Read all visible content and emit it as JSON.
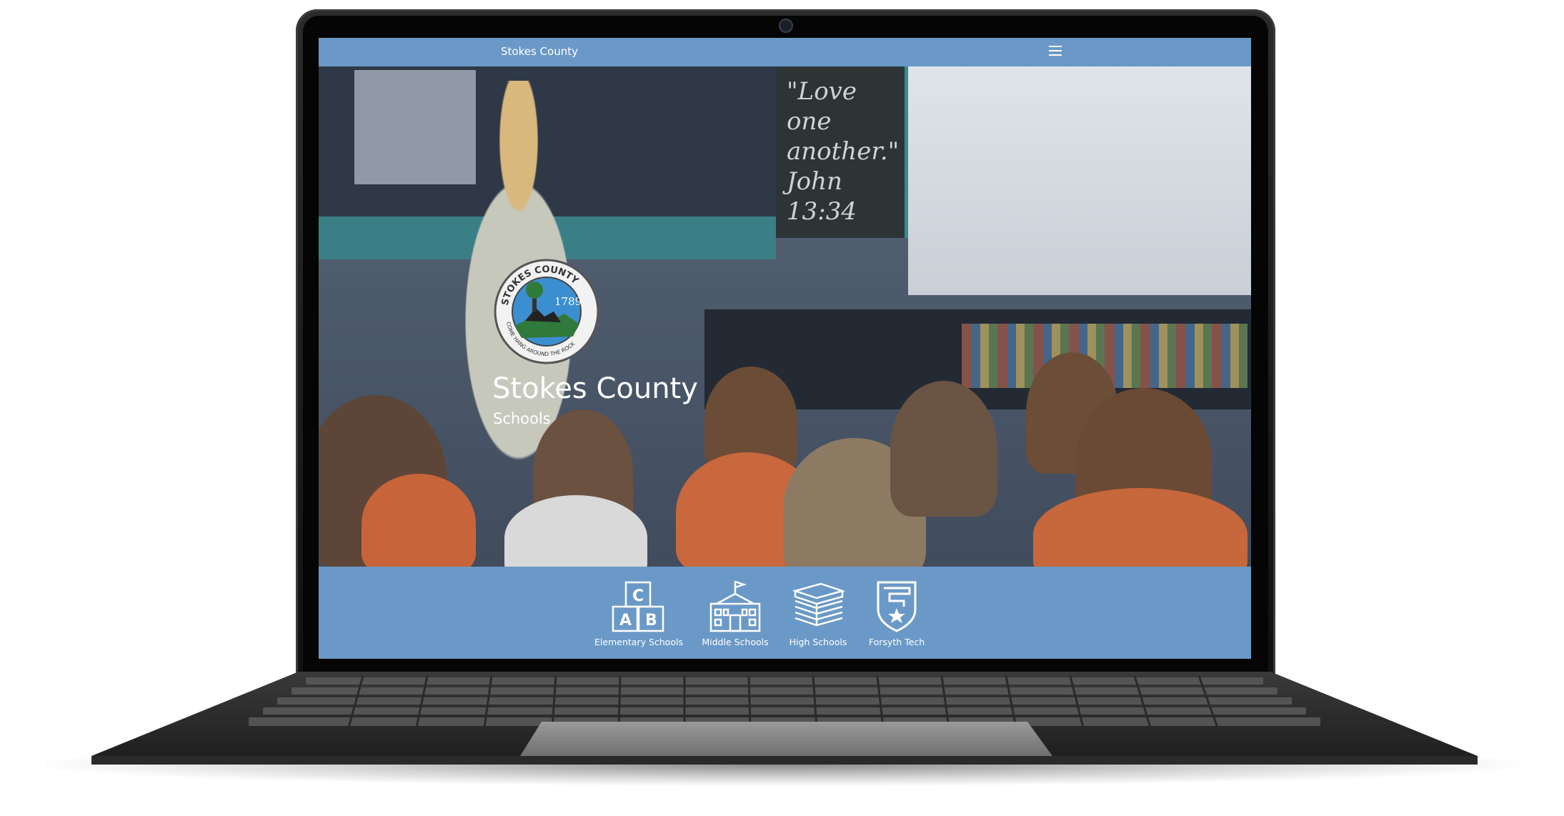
{
  "navbar": {
    "site_title": "Stokes County",
    "menu_icon": "hamburger-menu-icon"
  },
  "hero": {
    "logo": {
      "top_text": "STOKES COUNTY",
      "year": "1789",
      "bottom_text": "COME HANG AROUND THE ROCK"
    },
    "chalkboard_text": "\"Love one another.\" John 13:34",
    "title": "Stokes County",
    "subtitle": "Schools"
  },
  "school_links": [
    {
      "label": "Elementary Schools",
      "icon": "abc-blocks-icon"
    },
    {
      "label": "Middle Schools",
      "icon": "schoolhouse-icon"
    },
    {
      "label": "High Schools",
      "icon": "book-stack-icon"
    },
    {
      "label": "Forsyth Tech",
      "icon": "shield-star-icon"
    }
  ],
  "colors": {
    "brand_blue": "#6b99c7",
    "laptop_frame": "#1a1a1a"
  }
}
